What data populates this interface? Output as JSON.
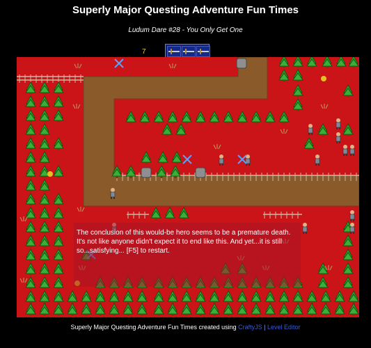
{
  "header": {
    "title": "Superly Major Questing Adventure Fun Times",
    "subtitle": "Ludum Dare #28 - You Only Get One"
  },
  "hud": {
    "counter": "7",
    "inventory_slots": [
      "sword-icon",
      "sword-icon",
      "sword-icon"
    ]
  },
  "game": {
    "death_message": "The conclusion of this would-be hero seems to be a premature death. It's not like anyone didn't expect it to end like this. And yet...it is still so...satisfying... [F5] to restart."
  },
  "footer": {
    "credit_text": "Superly Major Questing Adventure Fun Times created using",
    "crafty_link": "CraftyJS",
    "separator": "|",
    "editor_link": "Level Editor"
  },
  "colors": {
    "field_red": "#cb1418",
    "path_brown": "#8a5a2b",
    "tree_green": "#2e9c2a",
    "link_blue": "#3a5bd6"
  }
}
